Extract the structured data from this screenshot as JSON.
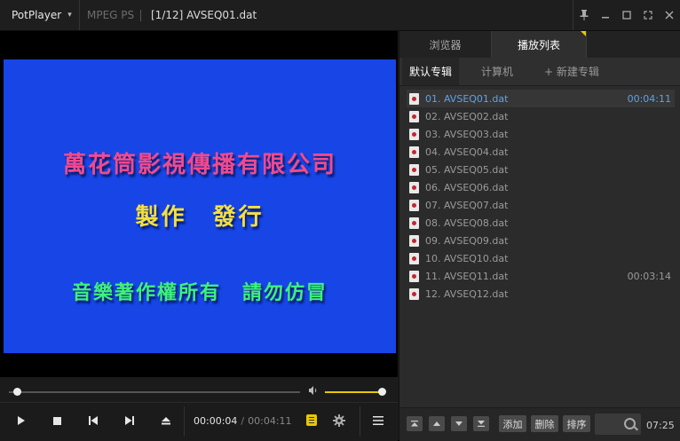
{
  "titlebar": {
    "app_name": "PotPlayer",
    "format": "MPEG PS",
    "title": "[1/12] AVSEQ01.dat"
  },
  "video": {
    "line1": "萬花筒影視傳播有限公司",
    "line2": "製作　發行",
    "line3": "音樂著作權所有　請勿仿冒"
  },
  "controls": {
    "current_time": "00:00:04",
    "total_time": "00:04:11",
    "seek_progress": 0.02,
    "volume_level": 0.95
  },
  "panel": {
    "tabs": [
      "浏览器",
      "播放列表"
    ],
    "active_tab": "播放列表",
    "sub_tabs": [
      "默认专辑",
      "计算机",
      "+ 新建专辑"
    ],
    "items": [
      {
        "label": "01. AVSEQ01.dat",
        "duration": "00:04:11",
        "active": true
      },
      {
        "label": "02. AVSEQ02.dat",
        "duration": ""
      },
      {
        "label": "03. AVSEQ03.dat",
        "duration": ""
      },
      {
        "label": "04. AVSEQ04.dat",
        "duration": ""
      },
      {
        "label": "05. AVSEQ05.dat",
        "duration": ""
      },
      {
        "label": "06. AVSEQ06.dat",
        "duration": ""
      },
      {
        "label": "07. AVSEQ07.dat",
        "duration": ""
      },
      {
        "label": "08. AVSEQ08.dat",
        "duration": ""
      },
      {
        "label": "09. AVSEQ09.dat",
        "duration": ""
      },
      {
        "label": "10. AVSEQ10.dat",
        "duration": ""
      },
      {
        "label": "11. AVSEQ11.dat",
        "duration": "00:03:14"
      },
      {
        "label": "12. AVSEQ12.dat",
        "duration": ""
      }
    ],
    "buttons": {
      "add": "添加",
      "delete": "删除",
      "sort": "排序"
    },
    "total_duration": "07:25"
  },
  "colors": {
    "accent": "#e8c800",
    "active_item": "#5ea2e8",
    "video_bg": "#1745e6"
  }
}
